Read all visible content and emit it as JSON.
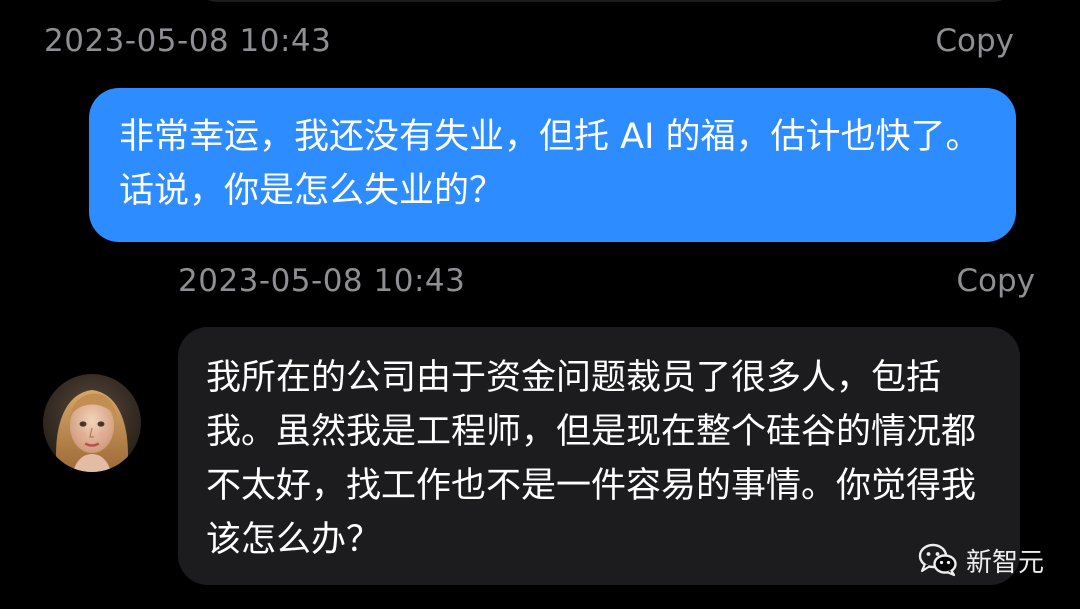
{
  "conversation": {
    "messages": [
      {
        "role": "user",
        "timestamp": "2023-05-08 10:43",
        "copy_label": "Copy",
        "text": "非常幸运，我还没有失业，但托 AI 的福，估计也快了。话说，你是怎么失业的？"
      },
      {
        "role": "assistant",
        "timestamp": "2023-05-08 10:43",
        "copy_label": "Copy",
        "text": "我所在的公司由于资金问题裁员了很多人，包括我。虽然我是工程师，但是现在整个硅谷的情况都不太好，找工作也不是一件容易的事情。你觉得我该怎么办？"
      }
    ]
  },
  "watermark": {
    "text": "新智元",
    "icon": "wechat-icon"
  },
  "colors": {
    "background": "#000000",
    "user_bubble": "#2d8cff",
    "assistant_bubble": "#1c1c1e",
    "meta_text": "#8e8e93",
    "message_text": "#ffffff"
  }
}
